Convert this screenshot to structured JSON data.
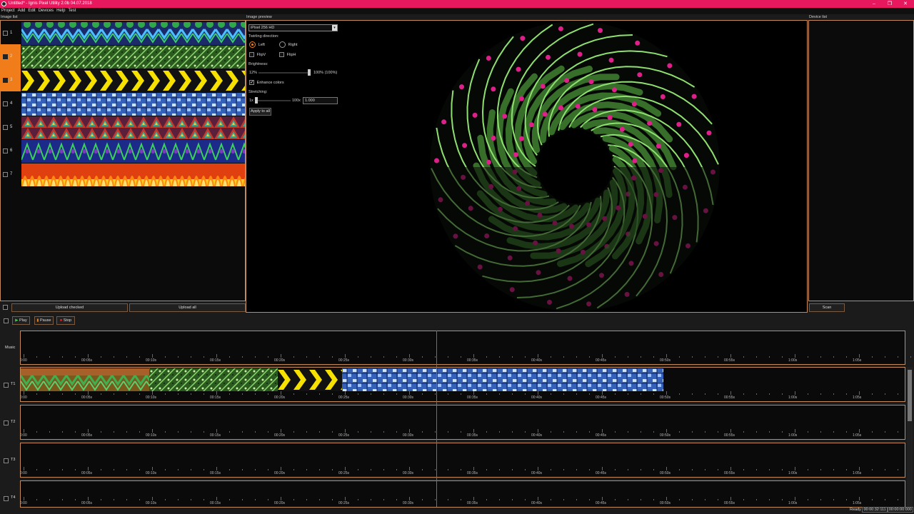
{
  "window": {
    "title": "Untitled* - Ignis Pixel Utility 2.0b 04.07.2018",
    "controls": [
      "–",
      "❐",
      "✕"
    ]
  },
  "menu": [
    "Project",
    "Add",
    "Edit",
    "Devices",
    "Help",
    "Test"
  ],
  "image_list": {
    "label": "Image list",
    "rows": [
      {
        "num": "1",
        "pattern": "chevron-green",
        "selected": false
      },
      {
        "num": "2",
        "pattern": "green-noise",
        "selected": true
      },
      {
        "num": "3",
        "pattern": "yellow-arrows",
        "selected": true
      },
      {
        "num": "4",
        "pattern": "blue-circuit",
        "selected": false
      },
      {
        "num": "5",
        "pattern": "triangles",
        "selected": false
      },
      {
        "num": "6",
        "pattern": "green-hearts",
        "selected": false
      },
      {
        "num": "7",
        "pattern": "fire",
        "selected": false
      }
    ],
    "upload_checked": "Upload checked",
    "upload_all": "Upload all"
  },
  "preview": {
    "label": "Image preview",
    "device_select": "iPixel 256 HD",
    "twirling_label": "Twirling direction:",
    "left_label": "Left",
    "right_label": "Right",
    "twirl": "left",
    "flipv_label": "FlipV",
    "fliph_label": "FlipH",
    "brightness_label": "Brightness:",
    "brightness_min": "12%",
    "brightness_value_text": "100% (100%)",
    "brightness_level": 1.0,
    "enhance_label": "Enhance colors",
    "enhance_checked": true,
    "stretching_label": "Stretching:",
    "stretch_min": "1x",
    "stretch_max": "100x",
    "stretch_value": "1.000",
    "apply_all": "Apply to all"
  },
  "device_list": {
    "label": "Device list",
    "scan": "Scan"
  },
  "transport": {
    "play": "Play",
    "pause": "Pause",
    "stop": "Stop"
  },
  "timeline": {
    "ticks": [
      "0:00",
      "00:05s",
      "00:10s",
      "00:15s",
      "00:20s",
      "00:25s",
      "00:30s",
      "00:35s",
      "00:40s",
      "00:45s",
      "00:50s",
      "00:55s",
      "1:00s",
      "1:05s"
    ],
    "tracks": [
      {
        "label": "Music"
      },
      {
        "label": "T1"
      },
      {
        "label": "T2"
      },
      {
        "label": "T3"
      },
      {
        "label": "T4"
      }
    ],
    "t1_clips": [
      {
        "pattern": "chevron-orange",
        "start": 0,
        "end": 10
      },
      {
        "pattern": "green-noise",
        "start": 10,
        "end": 20
      },
      {
        "pattern": "yellow-arrows",
        "start": 20,
        "end": 25
      },
      {
        "pattern": "blue-circuit",
        "start": 25,
        "end": 50
      }
    ],
    "playhead_time": 32.1
  },
  "status": {
    "ready": "Ready",
    "time1": "00:00:32:111",
    "time2": "00:00:00:000"
  },
  "colors": {
    "accent": "#e8185e",
    "border": "#c38b5a",
    "selection": "#f07d1a"
  }
}
